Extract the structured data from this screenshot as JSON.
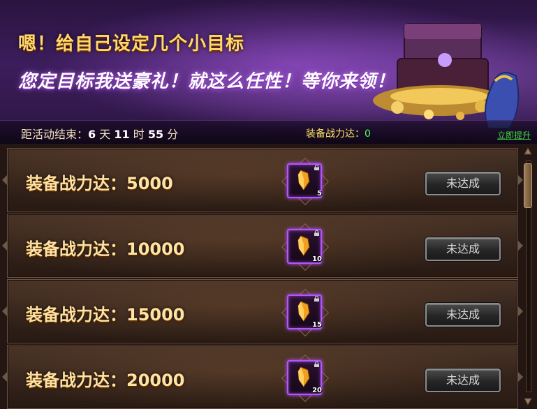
{
  "banner": {
    "title": "嗯！给自己设定几个小目标",
    "subtitle": "您定目标我送豪礼！就这么任性！等你来领！"
  },
  "status_bar": {
    "countdown_prefix": "距活动结束：",
    "days": "6",
    "days_unit": "天",
    "hours": "11",
    "hours_unit": "时",
    "minutes": "55",
    "minutes_unit": "分",
    "power_label": "装备战力达：",
    "power_value": "0",
    "upgrade_link": "立即提升"
  },
  "goals": [
    {
      "label": "装备战力达：5000",
      "reward_count": "5",
      "status": "未达成"
    },
    {
      "label": "装备战力达：10000",
      "reward_count": "10",
      "status": "未达成"
    },
    {
      "label": "装备战力达：15000",
      "reward_count": "15",
      "status": "未达成"
    },
    {
      "label": "装备战力达：20000",
      "reward_count": "20",
      "status": "未达成"
    }
  ],
  "icons": {
    "reward_item": "orange-crystal-icon",
    "lock": "lock-icon",
    "scroll_up": "arrow-up-icon",
    "scroll_down": "arrow-down-icon"
  },
  "colors": {
    "item_frame": "#b455ff",
    "goal_text": "#ffe3a3",
    "link": "#3ddc3d",
    "power_value": "#55ff55"
  },
  "scroll_position": 0.0
}
